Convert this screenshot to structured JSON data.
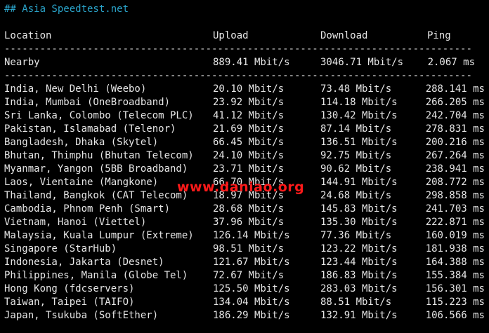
{
  "title": "## Asia Speedtest.net",
  "headers": {
    "location": "Location",
    "upload": "Upload",
    "download": "Download",
    "ping": "Ping"
  },
  "separator": "-------------------------------------------------------------------------------",
  "nearby": {
    "location": "Nearby",
    "upload": "889.41 Mbit/s",
    "download": "3046.71 Mbit/s",
    "ping": "2.067 ms"
  },
  "rows": [
    {
      "location": "India, New Delhi (Weebo)",
      "upload": "20.10 Mbit/s",
      "download": "73.48 Mbit/s",
      "ping": "288.141 ms"
    },
    {
      "location": "India, Mumbai (OneBroadband)",
      "upload": "23.92 Mbit/s",
      "download": "114.18 Mbit/s",
      "ping": "266.205 ms"
    },
    {
      "location": "Sri Lanka, Colombo (Telecom PLC)",
      "upload": "41.12 Mbit/s",
      "download": "130.42 Mbit/s",
      "ping": "242.704 ms"
    },
    {
      "location": "Pakistan, Islamabad (Telenor)",
      "upload": "21.69 Mbit/s",
      "download": "87.14 Mbit/s",
      "ping": "278.831 ms"
    },
    {
      "location": "Bangladesh, Dhaka (Skytel)",
      "upload": "66.45 Mbit/s",
      "download": "136.51 Mbit/s",
      "ping": "200.216 ms"
    },
    {
      "location": "Bhutan, Thimphu (Bhutan Telecom)",
      "upload": "24.10 Mbit/s",
      "download": "92.75 Mbit/s",
      "ping": "267.264 ms"
    },
    {
      "location": "Myanmar, Yangon (5BB Broadband)",
      "upload": "23.71 Mbit/s",
      "download": "90.62 Mbit/s",
      "ping": "238.941 ms"
    },
    {
      "location": "Laos, Vientaine (Mangkone)",
      "upload": "66.70 Mbit/s",
      "download": "144.91 Mbit/s",
      "ping": "208.772 ms"
    },
    {
      "location": "Thailand, Bangkok (CAT Telecom)",
      "upload": "18.97 Mbit/s",
      "download": "24.68 Mbit/s",
      "ping": "298.858 ms"
    },
    {
      "location": "Cambodia, Phnom Penh (Smart)",
      "upload": "28.68 Mbit/s",
      "download": "145.83 Mbit/s",
      "ping": "241.703 ms"
    },
    {
      "location": "Vietnam, Hanoi (Viettel)",
      "upload": "37.96 Mbit/s",
      "download": "135.30 Mbit/s",
      "ping": "222.871 ms"
    },
    {
      "location": "Malaysia, Kuala Lumpur (Extreme)",
      "upload": "126.14 Mbit/s",
      "download": "77.36 Mbit/s",
      "ping": "160.019 ms"
    },
    {
      "location": "Singapore (StarHub)",
      "upload": "98.51 Mbit/s",
      "download": "123.22 Mbit/s",
      "ping": "181.938 ms"
    },
    {
      "location": "Indonesia, Jakarta (Desnet)",
      "upload": "121.67 Mbit/s",
      "download": "123.44 Mbit/s",
      "ping": "164.388 ms"
    },
    {
      "location": "Philippines, Manila (Globe Tel)",
      "upload": "72.67 Mbit/s",
      "download": "186.83 Mbit/s",
      "ping": "155.384 ms"
    },
    {
      "location": "Hong Kong (fdcservers)",
      "upload": "125.50 Mbit/s",
      "download": "283.03 Mbit/s",
      "ping": "156.301 ms"
    },
    {
      "location": "Taiwan, Taipei (TAIFO)",
      "upload": "134.04 Mbit/s",
      "download": "88.51 Mbit/s",
      "ping": "115.223 ms"
    },
    {
      "location": "Japan, Tsukuba (SoftEther)",
      "upload": "186.29 Mbit/s",
      "download": "132.91 Mbit/s",
      "ping": "106.566 ms"
    }
  ],
  "watermark": "www.daniao.org",
  "colors": {
    "background": "#000000",
    "text": "#e6e6e6",
    "title": "#2aa3c9",
    "watermark": "#ff1a1a"
  }
}
